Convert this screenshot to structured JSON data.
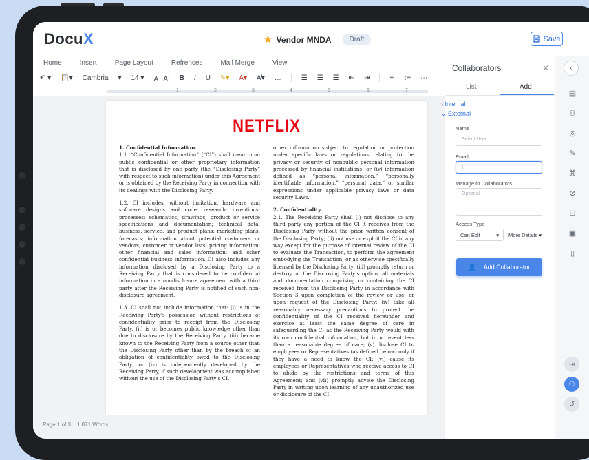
{
  "app": {
    "logo": "Docu",
    "logo_accent": "X"
  },
  "header": {
    "doc_title": "Vendor MNDA",
    "status_badge": "Draft",
    "save_label": "Save"
  },
  "ribbon": {
    "tabs": [
      "Home",
      "Insert",
      "Page Layout",
      "Refrences",
      "Mail Merge",
      "View"
    ],
    "font": "Cambria",
    "font_size": "14",
    "bold": "B",
    "italic": "I",
    "underline": "U",
    "more": "…"
  },
  "ruler": [
    "1",
    "2",
    "3",
    "4",
    "5",
    "6",
    "7"
  ],
  "document": {
    "brand": "NETFLIX",
    "left_column": [
      {
        "heading": "1. Confidential Information.",
        "text": "1.1. “Confidential Information” (“CI”) shall mean non-public confidential or other proprietary information that is disclosed by one party (the “Disclosing Party” with respect to such information) under this Agreement or is obtained by the Receiving Party in connection with its dealings with the Disclosing Party."
      },
      {
        "heading": "",
        "text": "1.2. CI includes, without limitation, hardware and software designs and code; research; inventions; processes; schematics; drawings; product or service specifications and documentation; technical data; business, service, and product plans; marketing plans; forecasts; information about potential customers or vendors; customer or vendor lists; pricing information; other financial and sales information; and other confidential business information. CI also includes any information disclosed by a Disclosing Party to a Receiving Party that is considered to be confidential information in a nondisclosure agreement with a third party after the Receiving Party is notified of such non-disclosure agreement."
      },
      {
        "heading": "",
        "text": "1.3. CI shall not include information that: (i) is in the Receiving Party’s possession without restrictions of confidentiality prior to receipt from the Disclosing Party, (ii) is or becomes public knowledge other than due to disclosure by the Receiving Party, (iii) became known to the Receiving Party from a source other than the Disclosing Party other than by the breach of an obligation of confidentiality owed to the Disclosing Party; or (iv) is independently developed by the Receiving Party, if such development was accomplished without the use of the Disclosing Party’s CI."
      }
    ],
    "right_column": [
      {
        "heading": "",
        "text": "other information subject to regulation or protection under specific laws or regulations relating to the privacy or security of nonpublic personal information processed by financial institutions; or (iv) information defined as “personal information,” “personally identifiable information,” “personal data,” or similar expressions under applicable privacy laws or data security Laws."
      },
      {
        "heading": "2. Confidentiality.",
        "text": "2.1. The Receiving Party shall (i) not disclose to any third party any portion of the CI it receives from the Disclosing Party without the prior written consent of the Disclosing Party; (ii) not use or exploit the CI in any way except for the purpose of internal review of the CI to evaluate the Transaction, to perform the agreement embodying the Transaction, or as otherwise specifically licensed by the Disclosing Party; (iii) promptly return or destroy, at the Disclosing Party’s option, all materials and documentation comprising or containing the CI received from the Disclosing Party in accordance with Section 3 upon completion of the review or use, or upon request of the Disclosing Party; (iv) take all reasonably necessary precautions to protect the confidentiality of the CI received hereunder and exercise at least the same degree of care in safeguarding the CI as the Receiving Party would with its own confidential information, but in no event less than a reasonable degree of care; (v) disclose CI to employees or Representatives (as defined below) only if they have a need to know the CI; (vi) cause its employees or Representatives who receive access to CI to abide by the restrictions and terms of this Agreement; and (vii) promptly advise the Disclosing Party in writing upon learning of any unauthorized use or disclosure of the CI."
      }
    ]
  },
  "status": {
    "page": "Page 1 of 3",
    "words": "1,871 Words"
  },
  "panel": {
    "title": "Collaborators",
    "tabs": [
      "List",
      "Add"
    ],
    "internal": "Internal",
    "external": "External",
    "name_label": "Name",
    "name_placeholder": "Select User",
    "email_label": "Email",
    "email_value": "|",
    "manage_label": "Manage to Collaborators",
    "manage_placeholder": "Optional",
    "access_label": "Access Type",
    "access_value": "Can Edit",
    "more_details": "More Details",
    "add_button": "Add Collaborator"
  },
  "colors": {
    "accent": "#4a86e8",
    "brand_red": "#e50914",
    "star": "#f5a623"
  }
}
